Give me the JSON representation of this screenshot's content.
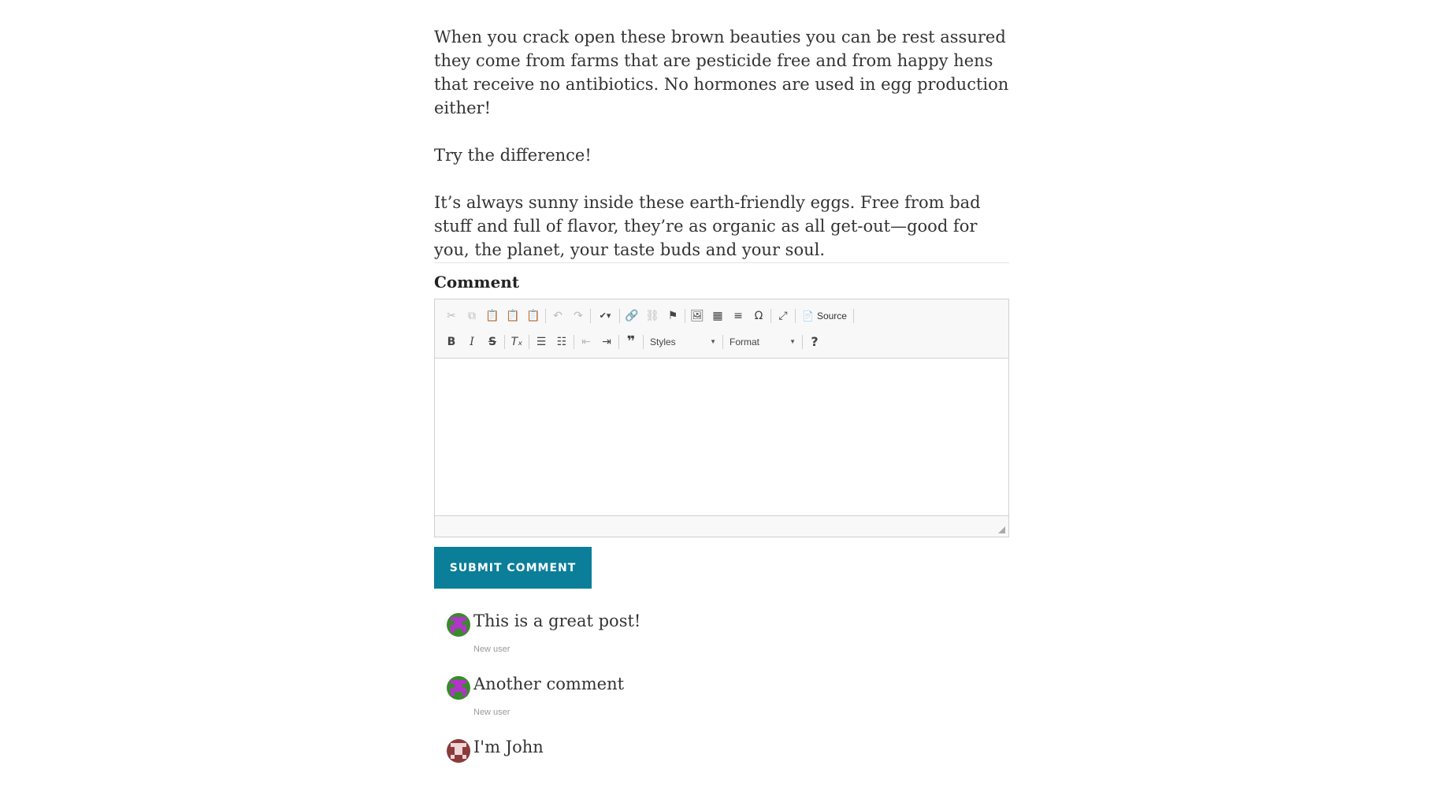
{
  "article": {
    "paragraphs": [
      "When you crack open these brown beauties you can be rest assured they come from farms that are pesticide free and from happy hens that receive no antibiotics. No hormones are used in egg production either!",
      "Try the difference!",
      "It’s always sunny inside these earth-friendly eggs. Free from bad stuff and full of flavor, they’re as organic as all get-out—good for you, the planet, your taste buds and your soul."
    ]
  },
  "comment_form": {
    "label": "Comment",
    "toolbar": {
      "source_label": "Source",
      "styles_label": "Styles",
      "format_label": "Format",
      "help_label": "?"
    },
    "submit_label": "SUBMIT COMMENT"
  },
  "comments": [
    {
      "text": "This is a great post!",
      "author": "New user",
      "avatar_colors": [
        "#3a8a2e",
        "#b135c7"
      ]
    },
    {
      "text": "Another comment",
      "author": "New user",
      "avatar_colors": [
        "#3a8a2e",
        "#b135c7"
      ]
    },
    {
      "text": "I'm John",
      "author": "",
      "avatar_colors": [
        "#8b3a3a",
        "#f0d6d6"
      ]
    }
  ],
  "colors": {
    "accent": "#0b7e99"
  }
}
